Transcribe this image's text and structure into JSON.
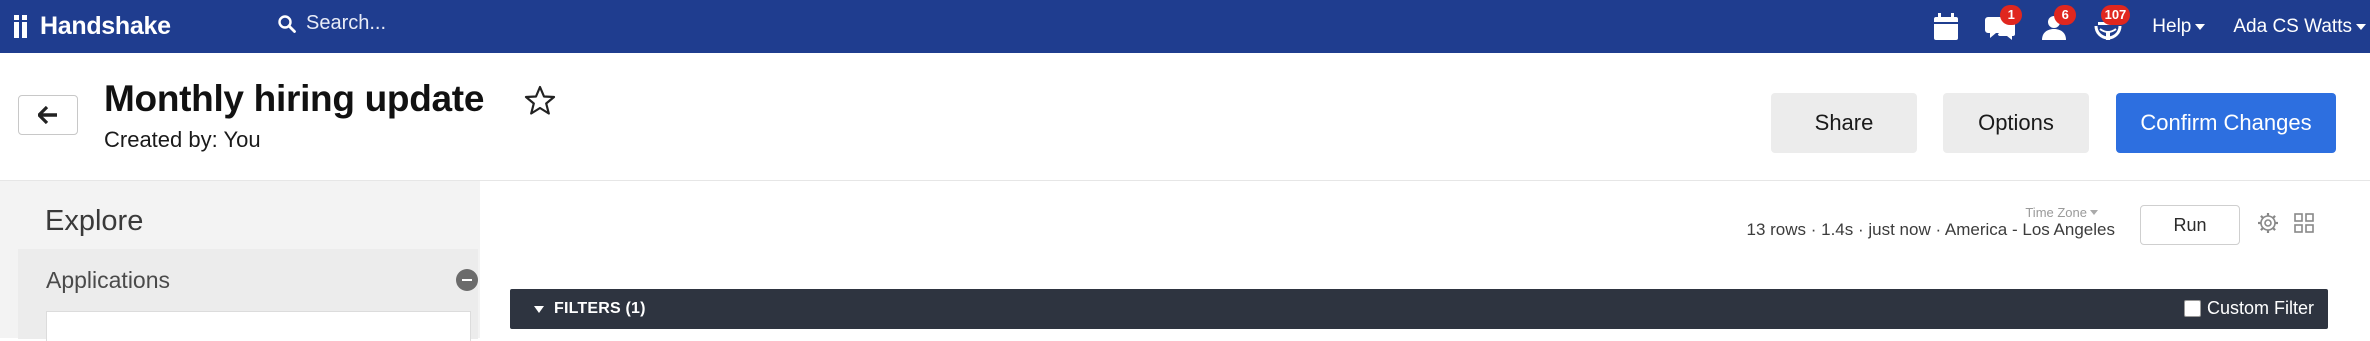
{
  "nav": {
    "brand": "Handshake",
    "search_placeholder": "Search...",
    "badges": {
      "messages": "1",
      "people": "6",
      "global": "107"
    },
    "help": "Help",
    "user": "Ada CS Watts"
  },
  "header": {
    "title": "Monthly hiring update",
    "created_by": "Created by: You",
    "share": "Share",
    "options": "Options",
    "confirm": "Confirm Changes"
  },
  "explore": {
    "title": "Explore",
    "sidebar_section": "Applications",
    "meta": "13 rows · 1.4s · just now · America - Los Angeles",
    "timezone_label": "Time Zone",
    "run": "Run",
    "filters": "FILTERS (1)",
    "custom_filter": "Custom Filter"
  },
  "colors": {
    "nav_bg": "#1f3d8f",
    "primary": "#2d6fe0",
    "badge": "#e0271f",
    "filters_bar": "#2e3440"
  }
}
